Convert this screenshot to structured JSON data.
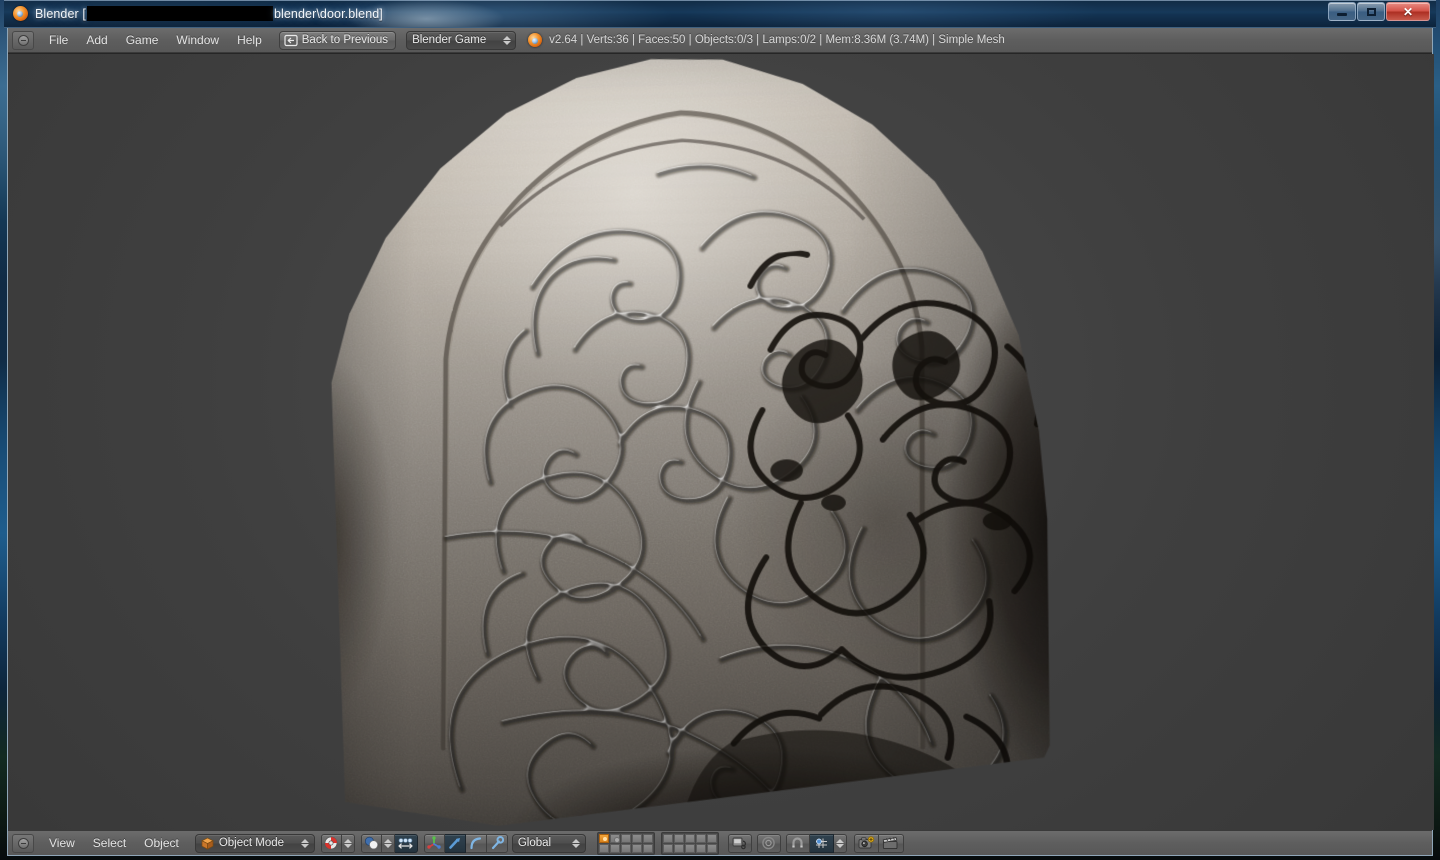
{
  "window": {
    "title_prefix": "Blender [",
    "title_redacted": true,
    "title_suffix": "blender\\door.blend]",
    "app_icon": "blender-logo-icon",
    "buttons": [
      {
        "name": "minimize-button",
        "label": "–",
        "glyph": "minimize-icon"
      },
      {
        "name": "maximize-button",
        "label": "□",
        "glyph": "maximize-icon"
      },
      {
        "name": "close-button",
        "label": "✕",
        "glyph": "close-icon"
      }
    ]
  },
  "top_header": {
    "editor_type_label": "editor-type-selector",
    "menus": [
      {
        "label": "File"
      },
      {
        "label": "Add"
      },
      {
        "label": "Game"
      },
      {
        "label": "Window"
      },
      {
        "label": "Help"
      }
    ],
    "back_button": {
      "label": "Back to Previous",
      "icon": "back-arrow-icon"
    },
    "engine_select": {
      "value": "Blender Game",
      "icon": "up-down-arrows-icon"
    },
    "stats": "v2.64 | Verts:36 | Faces:50 | Objects:0/3 | Lamps:0/2 | Mem:8.36M (3.74M) | Simple Mesh",
    "stats_parts": {
      "version": "v2.64",
      "verts": "Verts:36",
      "faces": "Faces:50",
      "objects": "Objects:0/3",
      "lamps": "Lamps:0/2",
      "memory": "Mem:8.36M (3.74M)",
      "active_object": "Simple Mesh"
    }
  },
  "viewport": {
    "background_color": "#3f3f3f",
    "shading": "textured",
    "object_description": "Arched stone door mesh with spiral relief carvings and dark weathered right edge"
  },
  "bottom_header": {
    "editor_type_label": "editor-type-selector",
    "menus": [
      {
        "label": "View"
      },
      {
        "label": "Select"
      },
      {
        "label": "Object"
      }
    ],
    "mode_select": {
      "value": "Object Mode",
      "icon": "object-mode-cube-icon"
    },
    "shading_select": {
      "value": "Texture",
      "icon": "texture-shading-sphere-icon"
    },
    "pivot_select": {
      "value": "Median Point",
      "icon": "pivot-sphere-icon"
    },
    "manipulator_toggle": {
      "icon": "manipulator-axis-icon",
      "active": true
    },
    "manipulator_modes": [
      {
        "name": "translate-manipulator",
        "icon": "translate-arrow-icon",
        "active": true
      },
      {
        "name": "rotate-manipulator",
        "icon": "rotate-arc-icon",
        "active": false
      },
      {
        "name": "scale-manipulator",
        "icon": "scale-handle-icon",
        "active": false
      }
    ],
    "transform_orientation": {
      "value": "Global",
      "icon": "up-down-arrows-icon"
    },
    "layers": {
      "block_1": [
        {
          "state": "active"
        },
        {
          "state": "used"
        },
        {
          "state": "empty"
        },
        {
          "state": "empty"
        },
        {
          "state": "empty"
        },
        {
          "state": "empty"
        },
        {
          "state": "empty"
        },
        {
          "state": "empty"
        },
        {
          "state": "empty"
        },
        {
          "state": "empty"
        }
      ],
      "block_2": [
        {
          "state": "empty"
        },
        {
          "state": "empty"
        },
        {
          "state": "empty"
        },
        {
          "state": "empty"
        },
        {
          "state": "empty"
        },
        {
          "state": "empty"
        },
        {
          "state": "empty"
        },
        {
          "state": "empty"
        },
        {
          "state": "empty"
        },
        {
          "state": "empty"
        }
      ]
    },
    "right_tools": [
      {
        "name": "lock-to-scene-button",
        "icon": "lock-scene-icon",
        "active": false
      },
      {
        "name": "proportional-edit-button",
        "icon": "proportional-circle-icon",
        "active": false
      },
      {
        "name": "snap-toggle-button",
        "icon": "magnet-icon",
        "active": false
      },
      {
        "name": "snap-target-select",
        "icon": "snap-crosshair-icon",
        "active": true
      },
      {
        "name": "render-opengl-image-button",
        "icon": "camera-render-icon",
        "active": false
      },
      {
        "name": "render-opengl-animation-button",
        "icon": "clapperboard-icon",
        "active": false
      }
    ]
  },
  "colors": {
    "header_gray": "#5e5e5e",
    "viewport_bg": "#3f3f3f",
    "accent_orange": "#f2a53a",
    "title_blue": "#14365 6",
    "close_red": "#d4544a"
  }
}
